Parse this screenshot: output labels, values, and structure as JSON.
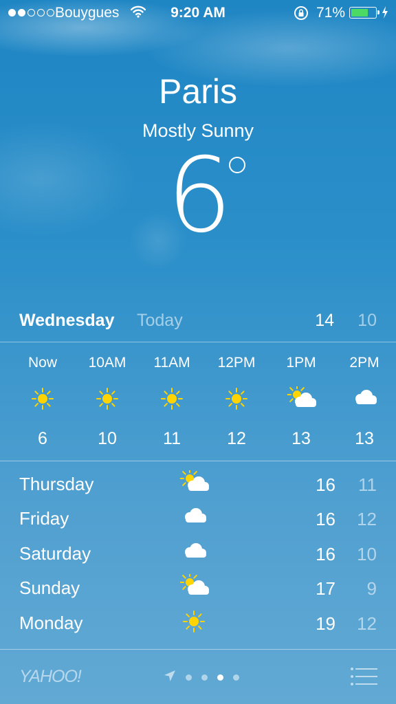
{
  "status_bar": {
    "signal_bars_filled": 2,
    "signal_bars_total": 5,
    "carrier": "Bouygues",
    "time": "9:20 AM",
    "battery_percent": "71%",
    "battery_level": 0.71,
    "battery_color": "#4cd964"
  },
  "header": {
    "city": "Paris",
    "condition": "Mostly Sunny",
    "temperature": "6"
  },
  "today": {
    "day": "Wednesday",
    "label": "Today",
    "high": "14",
    "low": "10"
  },
  "hourly": [
    {
      "time": "Now",
      "icon": "sun-icon",
      "temp": "6"
    },
    {
      "time": "10AM",
      "icon": "sun-icon",
      "temp": "10"
    },
    {
      "time": "11AM",
      "icon": "sun-icon",
      "temp": "11"
    },
    {
      "time": "12PM",
      "icon": "sun-icon",
      "temp": "12"
    },
    {
      "time": "1PM",
      "icon": "partly-cloudy-icon",
      "temp": "13"
    },
    {
      "time": "2PM",
      "icon": "cloud-icon",
      "temp": "13"
    }
  ],
  "daily": [
    {
      "day": "Thursday",
      "icon": "partly-cloudy-icon",
      "high": "16",
      "low": "11"
    },
    {
      "day": "Friday",
      "icon": "cloud-icon",
      "high": "16",
      "low": "12"
    },
    {
      "day": "Saturday",
      "icon": "cloud-icon",
      "high": "16",
      "low": "10"
    },
    {
      "day": "Sunday",
      "icon": "partly-cloudy-icon",
      "high": "17",
      "low": "9"
    },
    {
      "day": "Monday",
      "icon": "sun-icon",
      "high": "19",
      "low": "12"
    }
  ],
  "footer": {
    "brand": "YAHOO!",
    "page_count": 4,
    "active_page": 3
  },
  "colors": {
    "sun": "#ffd400",
    "cloud": "#ffffff"
  }
}
